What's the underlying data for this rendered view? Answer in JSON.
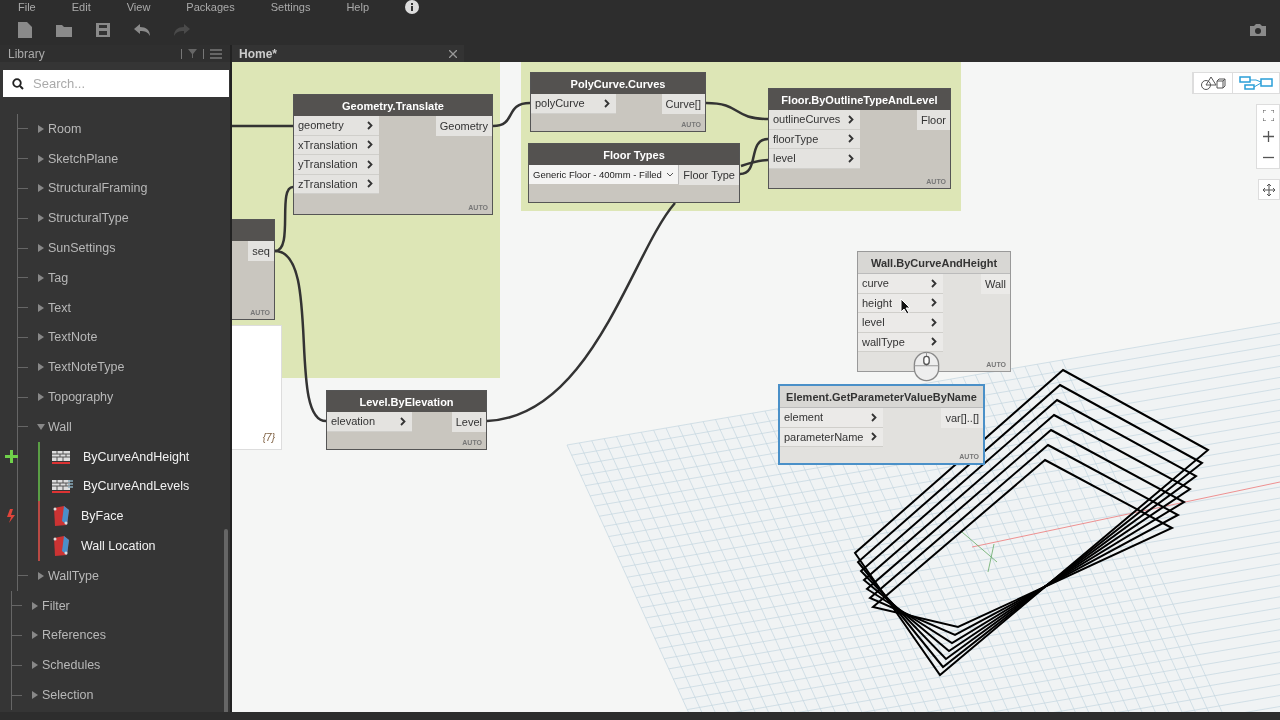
{
  "menu": [
    "File",
    "Edit",
    "View",
    "Packages",
    "Settings",
    "Help"
  ],
  "toolbar": [
    {
      "kind": "new",
      "disabled": false
    },
    {
      "kind": "open",
      "disabled": false
    },
    {
      "kind": "save",
      "disabled": false
    },
    {
      "kind": "undo",
      "disabled": false
    },
    {
      "kind": "redo",
      "disabled": true
    }
  ],
  "library": {
    "title": "Library",
    "search": {
      "placeholder": "Search..."
    },
    "element_types": [
      {
        "label": "Room",
        "expanded": false
      },
      {
        "label": "SketchPlane",
        "expanded": false
      },
      {
        "label": "StructuralFraming",
        "expanded": false
      },
      {
        "label": "StructuralType",
        "expanded": false
      },
      {
        "label": "SunSettings",
        "expanded": false
      },
      {
        "label": "Tag",
        "expanded": false
      },
      {
        "label": "Text",
        "expanded": false
      },
      {
        "label": "TextNote",
        "expanded": false
      },
      {
        "label": "TextNoteType",
        "expanded": false
      },
      {
        "label": "Topography",
        "expanded": false
      },
      {
        "label": "Wall",
        "expanded": true,
        "groups": [
          {
            "kind": "create",
            "items": [
              {
                "label": "ByCurveAndHeight"
              },
              {
                "label": "ByCurveAndLevels"
              }
            ]
          },
          {
            "kind": "action",
            "items": [
              {
                "label": "ByFace"
              },
              {
                "label": "Wall Location"
              }
            ]
          }
        ]
      },
      {
        "label": "WallType",
        "expanded": false
      }
    ],
    "categories": [
      {
        "label": "Filter",
        "expanded": false
      },
      {
        "label": "References",
        "expanded": false
      },
      {
        "label": "Schedules",
        "expanded": false
      },
      {
        "label": "Selection",
        "expanded": false
      }
    ]
  },
  "tabs": [
    {
      "label": "Home*",
      "selected": true
    }
  ],
  "canvas": {
    "view_toggle": [
      {
        "kind": "geometry",
        "selected": false
      },
      {
        "kind": "graph",
        "selected": true
      }
    ],
    "nodes": [
      {
        "dimmed": false,
        "selected": false,
        "outputs": [
          "seq"
        ],
        "lacing": "AUTO"
      },
      {
        "title": "Geometry.Translate",
        "dimmed": false,
        "selected": false,
        "inputs": [
          "geometry",
          "xTranslation",
          "yTranslation",
          "zTranslation"
        ],
        "outputs": [
          "Geometry"
        ],
        "lacing": "AUTO"
      },
      {
        "title": "PolyCurve.Curves",
        "dimmed": false,
        "selected": false,
        "inputs": [
          "polyCurve"
        ],
        "outputs": [
          "Curve[]"
        ],
        "lacing": "AUTO"
      },
      {
        "title": "Floor Types",
        "dimmed": false,
        "selected": false,
        "dropdown": "Generic Floor - 400mm - Filled",
        "outputs": [
          "Floor Type"
        ]
      },
      {
        "title": "Floor.ByOutlineTypeAndLevel",
        "dimmed": false,
        "selected": false,
        "inputs": [
          "outlineCurves",
          "floorType",
          "level"
        ],
        "outputs": [
          "Floor"
        ],
        "lacing": "AUTO"
      },
      {
        "title": "Level.ByElevation",
        "dimmed": false,
        "selected": false,
        "inputs": [
          "elevation"
        ],
        "outputs": [
          "Level"
        ],
        "lacing": "AUTO"
      },
      {
        "title": "Wall.ByCurveAndHeight",
        "dimmed": true,
        "selected": false,
        "inputs": [
          "curve",
          "height",
          "level",
          "wallType"
        ],
        "outputs": [
          "Wall"
        ],
        "lacing": "AUTO"
      },
      {
        "title": "Element.GetParameterValueByName",
        "dimmed": true,
        "selected": true,
        "inputs": [
          "element",
          "parameterName"
        ],
        "outputs": [
          "var[]..[]"
        ],
        "lacing": "AUTO"
      }
    ],
    "watch": {
      "value": "{7}"
    }
  }
}
